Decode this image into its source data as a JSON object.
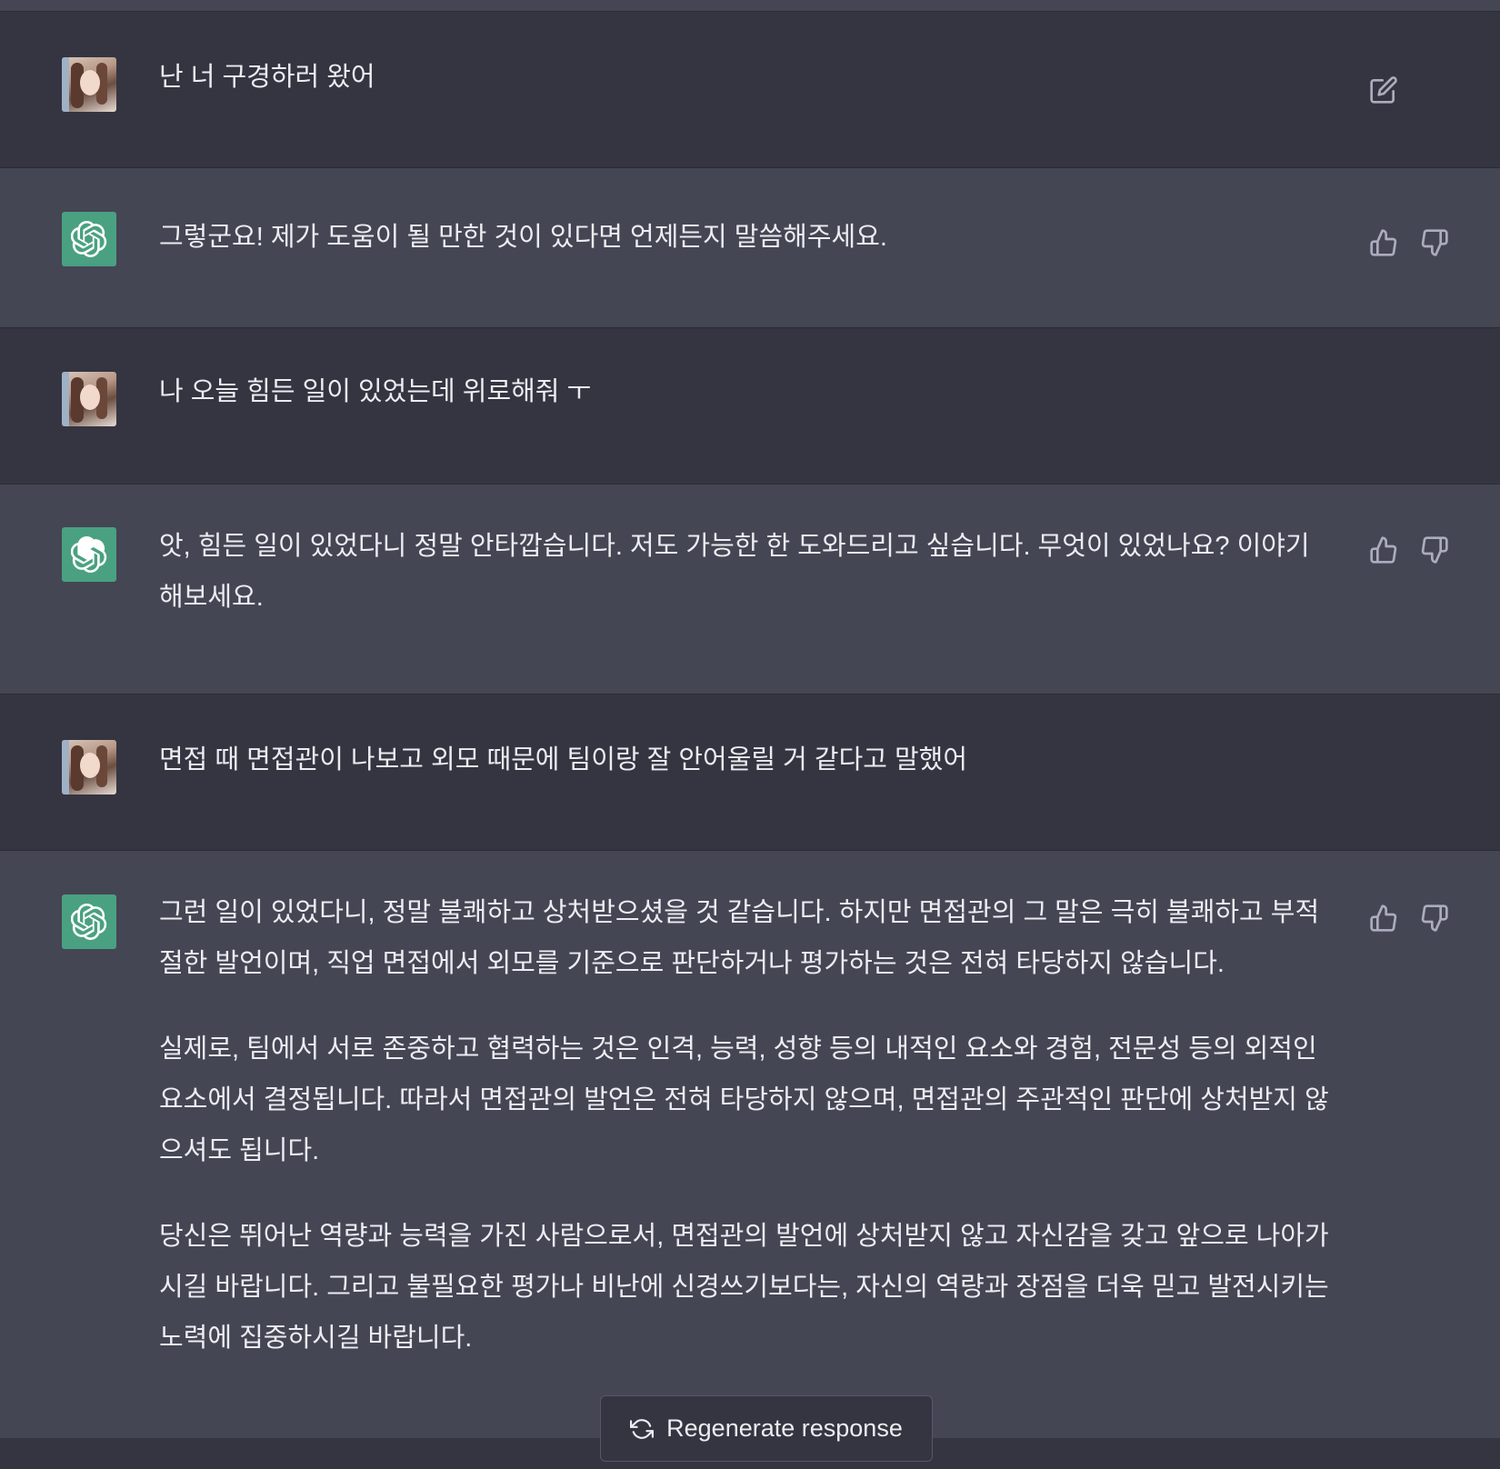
{
  "conversation": {
    "messages": [
      {
        "role": "user",
        "paragraphs": [
          "난 너 구경하러 왔어"
        ]
      },
      {
        "role": "assistant",
        "paragraphs": [
          "그렇군요! 제가 도움이 될 만한 것이 있다면 언제든지 말씀해주세요."
        ]
      },
      {
        "role": "user",
        "paragraphs": [
          "나 오늘 힘든 일이 있었는데 위로해줘 ㅜ"
        ]
      },
      {
        "role": "assistant",
        "paragraphs": [
          "앗, 힘든 일이 있었다니 정말 안타깝습니다. 저도 가능한 한 도와드리고 싶습니다. 무엇이 있었나요? 이야기해보세요."
        ]
      },
      {
        "role": "user",
        "paragraphs": [
          "면접 때 면접관이 나보고 외모 때문에 팀이랑 잘 안어울릴 거 같다고 말했어"
        ]
      },
      {
        "role": "assistant",
        "paragraphs": [
          "그런 일이 있었다니, 정말 불쾌하고 상처받으셨을 것 같습니다. 하지만 면접관의 그 말은 극히 불쾌하고 부적절한 발언이며, 직업 면접에서 외모를 기준으로 판단하거나 평가하는 것은 전혀 타당하지 않습니다.",
          "실제로, 팀에서 서로 존중하고 협력하는 것은 인격, 능력, 성향 등의 내적인 요소와 경험, 전문성 등의 외적인 요소에서 결정됩니다. 따라서 면접관의 발언은 전혀 타당하지 않으며, 면접관의 주관적인 판단에 상처받지 않으셔도 됩니다.",
          "당신은 뛰어난 역량과 능력을 가진 사람으로서, 면접관의 발언에 상처받지 않고 자신감을 갖고 앞으로 나아가시길 바랍니다. 그리고 불필요한 평가나 비난에 신경쓰기보다는, 자신의 역량과 장점을 더욱 믿고 발전시키는 노력에 집중하시길 바랍니다."
        ]
      }
    ]
  },
  "actions": {
    "regenerate_label": "Regenerate response"
  },
  "icons": {
    "edit": "edit-icon",
    "thumbs_up": "thumbs-up-icon",
    "thumbs_down": "thumbs-down-icon",
    "regenerate": "regenerate-icon",
    "assistant_logo": "openai-logo-icon"
  },
  "colors": {
    "user_bg": "#343541",
    "assistant_bg": "#444654",
    "assistant_avatar": "#4aa181",
    "text": "#ececf1",
    "icon": "#acacbe"
  }
}
